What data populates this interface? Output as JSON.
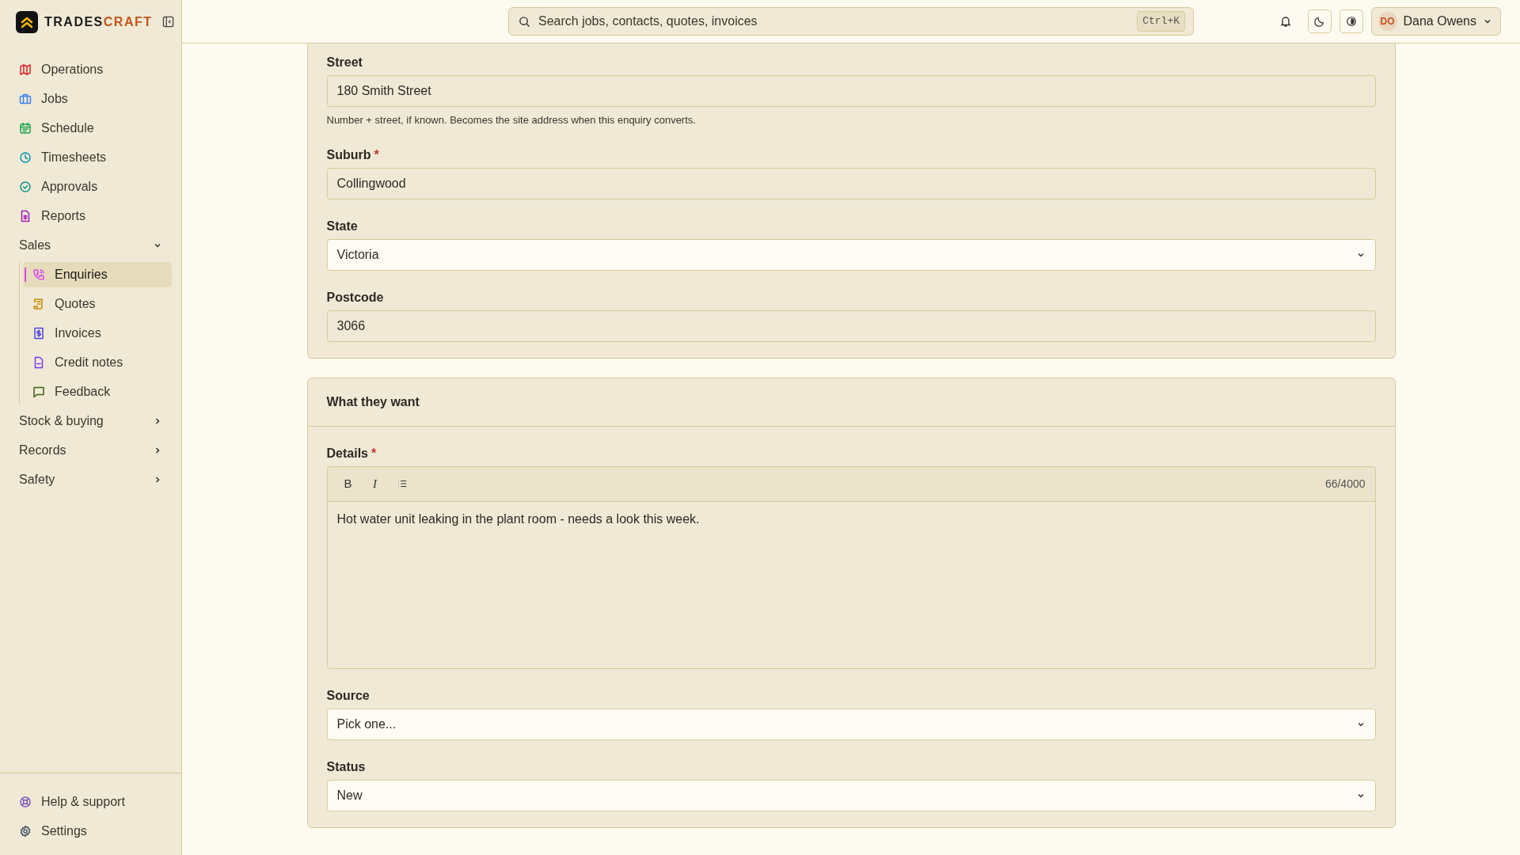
{
  "brand": {
    "part_1": "TRADES",
    "part_2": "CRAFT"
  },
  "search": {
    "placeholder": "Search jobs, contacts, quotes, invoices",
    "shortcut": "Ctrl+K"
  },
  "user": {
    "initials": "DO",
    "name": "Dana Owens"
  },
  "sidebar": {
    "items": [
      {
        "kind": "link",
        "label": "Operations",
        "selected": false
      },
      {
        "kind": "link",
        "label": "Jobs",
        "selected": false
      },
      {
        "kind": "link",
        "label": "Schedule",
        "selected": false
      },
      {
        "kind": "link",
        "label": "Timesheets",
        "selected": false
      },
      {
        "kind": "link",
        "label": "Approvals",
        "selected": false
      },
      {
        "kind": "link",
        "label": "Reports",
        "selected": false
      },
      {
        "kind": "group",
        "label": "Sales",
        "expanded": true,
        "children": [
          {
            "label": "Enquiries",
            "selected": true
          },
          {
            "label": "Quotes",
            "selected": false
          },
          {
            "label": "Invoices",
            "selected": false
          },
          {
            "label": "Credit notes",
            "selected": false
          },
          {
            "label": "Feedback",
            "selected": false
          }
        ]
      },
      {
        "kind": "group",
        "label": "Stock & buying",
        "expanded": false
      },
      {
        "kind": "group",
        "label": "Records",
        "expanded": false
      },
      {
        "kind": "group",
        "label": "Safety",
        "expanded": false
      }
    ],
    "footer_items": [
      {
        "label": "Help & support",
        "selected": false
      },
      {
        "label": "Settings",
        "selected": false
      }
    ]
  },
  "sections": [
    {
      "fields": [
        {
          "kind": "text",
          "label": "Street",
          "value": "180 Smith Street",
          "help": "Number + street, if known. Becomes the site address when this enquiry converts."
        },
        {
          "kind": "text",
          "label": "Suburb",
          "required_mark": "*",
          "value": "Collingwood"
        },
        {
          "kind": "select",
          "label": "State",
          "value": "Victoria"
        },
        {
          "kind": "text",
          "label": "Postcode",
          "value": "3066"
        }
      ]
    },
    {
      "title": "What they want",
      "fields": [
        {
          "kind": "editor",
          "label": "Details",
          "required_mark": "*",
          "toolbar": [
            "B",
            "I"
          ],
          "counter": "66/4000",
          "value": "Hot water unit leaking in the plant room - needs a look this week."
        },
        {
          "kind": "select",
          "label": "Source",
          "value": "Pick one..."
        },
        {
          "kind": "select",
          "label": "Status",
          "value": "New"
        }
      ]
    }
  ]
}
